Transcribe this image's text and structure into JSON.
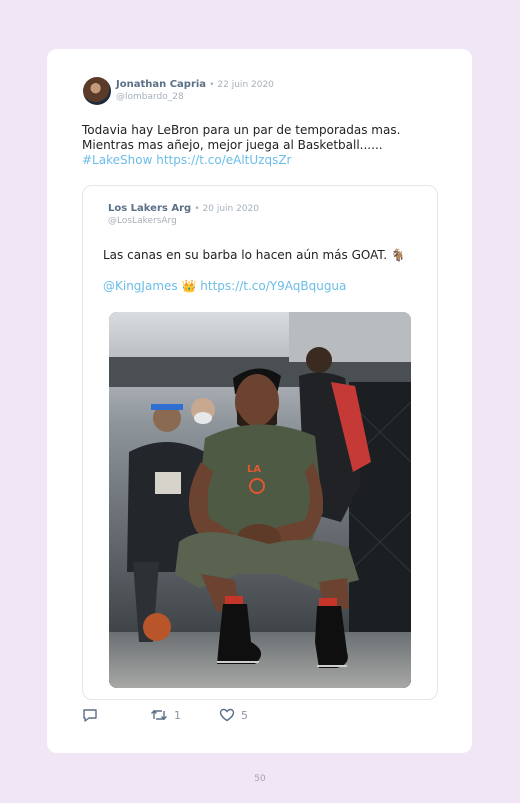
{
  "tweet": {
    "author_name": "Jonathan Capria",
    "date": "• 22 juin 2020",
    "handle": "@lombardo_28",
    "text_line1": "Todavia hay LeBron para un par de temporadas mas.",
    "text_line2": "Mientras mas añejo, mejor juega al Basketball......",
    "hashtag": "#LakeShow",
    "link": "https://t.co/eAltUzqsZr"
  },
  "quoted": {
    "author_name": "Los Lakers Arg",
    "date": "• 20 juin 2020",
    "handle": "@LosLakersArg",
    "text": "Las canas en su barba lo hacen aún más GOAT. 🐐",
    "mention": "@KingJames",
    "crown": "👑",
    "link": "https://t.co/Y9AqBqugua"
  },
  "actions": {
    "retweets": "1",
    "likes": "5"
  },
  "page_number": "50",
  "colors": {
    "link": "#6cbde8",
    "background": "#f1e6f6"
  },
  "icons": [
    "reply-icon",
    "retweet-icon",
    "heart-icon"
  ]
}
